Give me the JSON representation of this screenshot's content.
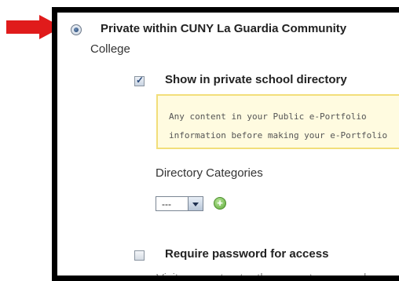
{
  "privacy_option": {
    "title": "Private within CUNY La Guardia Community",
    "subtitle": "College"
  },
  "directory": {
    "show_label": "Show in private school directory",
    "notice_line1": "Any content in your Public e-Portfolio",
    "notice_line2": "information before making your e-Portfolio",
    "categories_label": "Directory Categories",
    "select_value": "---",
    "add_button": "+"
  },
  "password": {
    "label": "Require password for access",
    "help_text": "Visitors must enter the correct password"
  },
  "colors": {
    "arrow": "#e01b1b",
    "notice_bg": "#fffbe0",
    "notice_border": "#f2de7a"
  }
}
